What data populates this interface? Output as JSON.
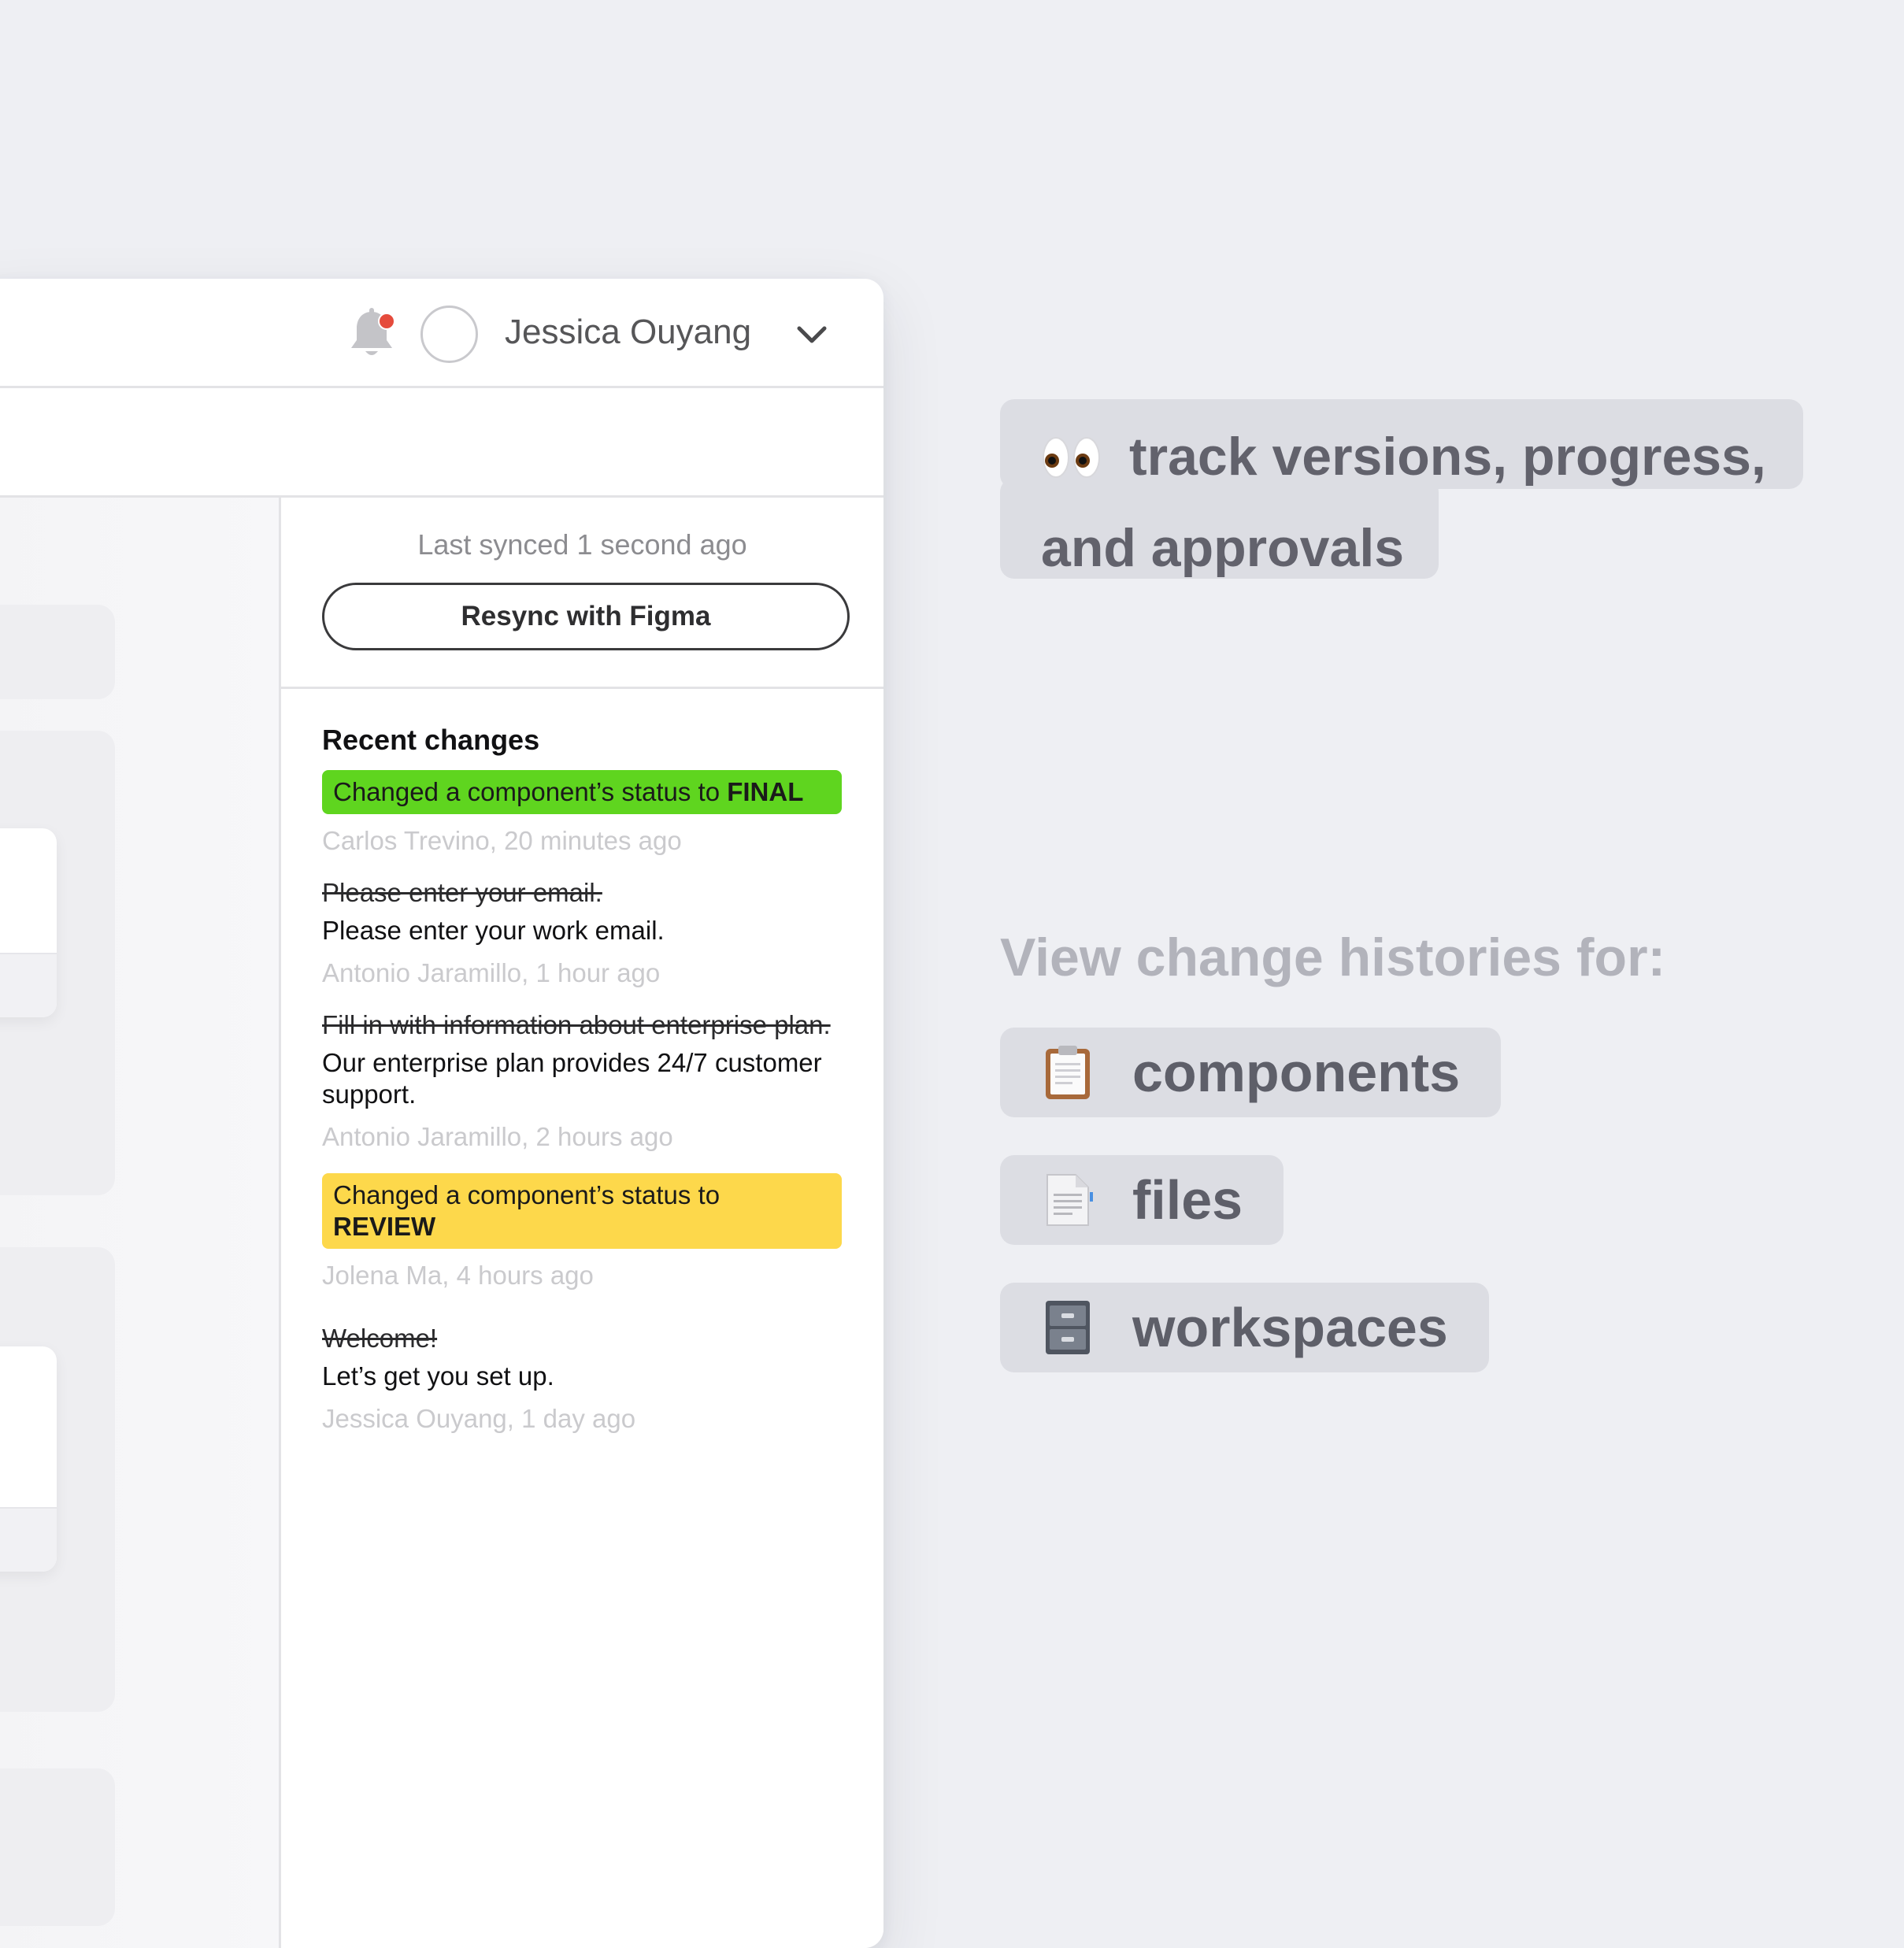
{
  "header": {
    "user_name": "Jessica Ouyang"
  },
  "sync": {
    "status_text": "Last synced 1 second ago",
    "resync_label": "Resync with Figma"
  },
  "changes": {
    "title": "Recent changes",
    "items": [
      {
        "type": "status",
        "prefix": "Changed a component’s status to ",
        "status": "FINAL",
        "color": "#5fd51f",
        "meta": "Carlos Trevino, 20 minutes ago"
      },
      {
        "type": "text",
        "old": "Please enter your email.",
        "new": "Please enter your work email.",
        "meta": "Antonio Jaramillo, 1 hour ago"
      },
      {
        "type": "text",
        "old": "Fill in with information about enterprise plan.",
        "new": "Our enterprise plan provides 24/7 customer support.",
        "meta": "Antonio Jaramillo, 2 hours ago"
      },
      {
        "type": "status",
        "prefix": "Changed a component’s status to ",
        "status": "REVIEW",
        "color": "#fdd84b",
        "meta": "Jolena Ma, 4 hours ago"
      },
      {
        "type": "text",
        "old": "Welcome!",
        "new": "Let’s get you set up.",
        "meta": "Jessica Ouyang, 1 day ago"
      }
    ]
  },
  "marketing": {
    "headline_line1": "track versions, progress,",
    "headline_line2": "and approvals",
    "headline_icon": "eyes-icon",
    "view_title": "View change histories for:",
    "list": [
      {
        "label": "components",
        "icon": "clipboard-icon"
      },
      {
        "label": "files",
        "icon": "document-icon"
      },
      {
        "label": "workspaces",
        "icon": "file-cabinet-icon"
      }
    ]
  },
  "colors": {
    "background": "#eeeff3",
    "notification_dot": "#e54b3c",
    "final_status": "#5fd51f",
    "review_status": "#fdd84b",
    "tag_background": "#dcdde3"
  }
}
